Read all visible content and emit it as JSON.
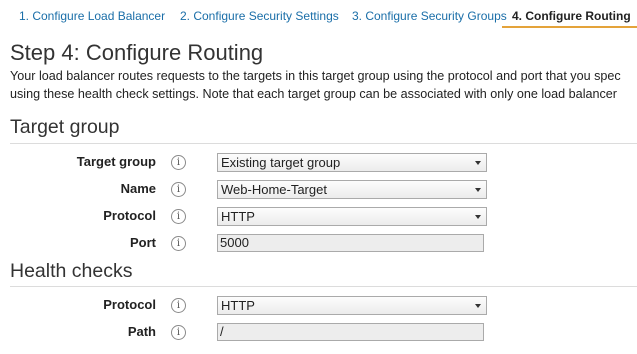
{
  "wizard": {
    "steps": [
      {
        "label": "1. Configure Load Balancer"
      },
      {
        "label": "2. Configure Security Settings"
      },
      {
        "label": "3. Configure Security Groups"
      },
      {
        "label": "4. Configure Routing"
      }
    ],
    "active_step": 4
  },
  "page": {
    "title": "Step 4: Configure Routing",
    "description_line1": "Your load balancer routes requests to the targets in this target group using the protocol and port that you spec",
    "description_line2": "using these health check settings. Note that each target group can be associated with only one load balancer"
  },
  "target_group": {
    "heading": "Target group",
    "fields": {
      "target_group": {
        "label": "Target group",
        "value": "Existing target group"
      },
      "name": {
        "label": "Name",
        "value": "Web-Home-Target"
      },
      "protocol": {
        "label": "Protocol",
        "value": "HTTP"
      },
      "port": {
        "label": "Port",
        "value": "5000"
      }
    }
  },
  "health_checks": {
    "heading": "Health checks",
    "fields": {
      "protocol": {
        "label": "Protocol",
        "value": "HTTP"
      },
      "path": {
        "label": "Path",
        "value": "/"
      }
    }
  },
  "icons": {
    "info": "info-icon",
    "dropdown": "caret-down-icon"
  },
  "colors": {
    "link": "#1a6ea8",
    "active_tab_underline": "#e4a33a",
    "disabled_input_bg": "#ededed"
  }
}
